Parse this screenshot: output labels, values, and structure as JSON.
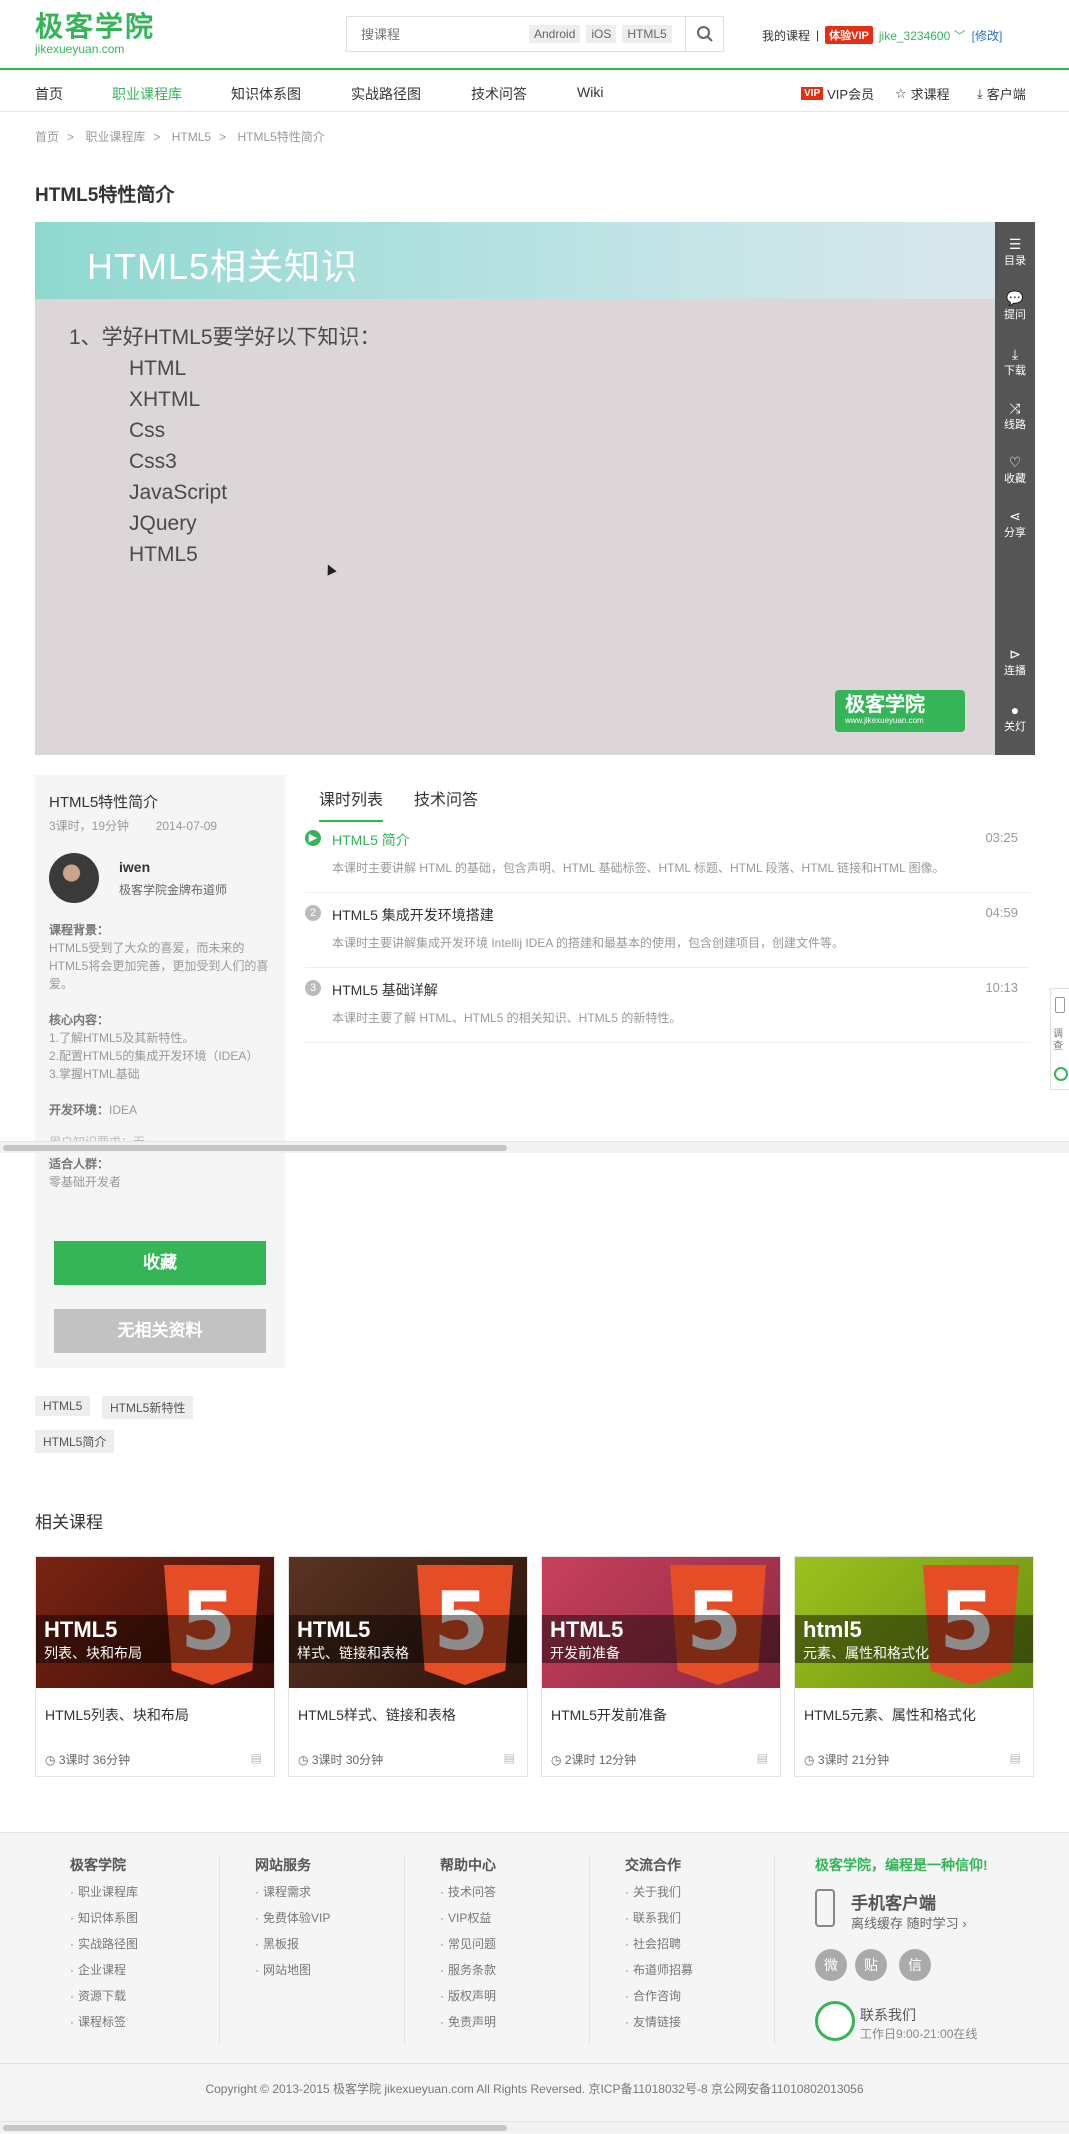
{
  "header": {
    "logo_cn": "极客学院",
    "logo_en": "jikexueyuan.com",
    "search_placeholder": "搜课程",
    "search_tags": [
      "Android",
      "iOS",
      "HTML5"
    ],
    "my_courses": "我的课程",
    "sep": "|",
    "vip_badge": "体验VIP",
    "username": "jike_3234600",
    "edit": "[修改]"
  },
  "nav": {
    "items": [
      "首页",
      "职业课程库",
      "知识体系图",
      "实战路径图",
      "技术问答",
      "Wiki"
    ],
    "right_vip_tag": "VIP",
    "right_vip": "VIP会员",
    "right_ask": "求课程",
    "right_client": "客户端"
  },
  "breadcrumb": [
    "首页",
    "职业课程库",
    "HTML5",
    "HTML5特性简介"
  ],
  "breadcrumb_sep": ">",
  "page_title": "HTML5特性简介",
  "slide": {
    "title": "HTML5相关知识",
    "line1": "1、学好HTML5要学好以下知识：",
    "items": [
      "HTML",
      "XHTML",
      "Css",
      "Css3",
      "JavaScript",
      "JQuery",
      "HTML5"
    ],
    "watermark": "极客学院",
    "watermark_en": "www.jikexueyuan.com"
  },
  "player_sidebar": [
    {
      "icon": "list-icon",
      "label": "目录"
    },
    {
      "icon": "question-icon",
      "label": "提问"
    },
    {
      "icon": "download-icon",
      "label": "下载"
    },
    {
      "icon": "route-icon",
      "label": "线路"
    },
    {
      "icon": "heart-icon",
      "label": "收藏"
    },
    {
      "icon": "share-icon",
      "label": "分享"
    },
    {
      "icon": "autoplay-icon",
      "label": "连播"
    },
    {
      "icon": "lamp-icon",
      "label": "关灯"
    }
  ],
  "course_info": {
    "title": "HTML5特性简介",
    "lessons_time": "3课时，19分钟",
    "date": "2014-07-09",
    "teacher": "iwen",
    "teacher_title": "极客学院金牌布道师",
    "bg_label": "课程背景：",
    "bg_text": "HTML5受到了大众的喜爱，而未来的HTML5将会更加完善，更加受到人们的喜爱。",
    "core_label": "核心内容：",
    "core_items": [
      "1.了解HTML5及其新特性。",
      "2.配置HTML5的集成开发环境（IDEA）",
      "3.掌握HTML基础"
    ],
    "env_label": "开发环境：",
    "env_value": "IDEA",
    "cut_text": "用户知识要求：无",
    "audience_label": "适合人群：",
    "audience_value": "零基础开发者",
    "btn_collect": "收藏",
    "btn_no_material": "无相关资料"
  },
  "tabs": [
    "课时列表",
    "技术问答"
  ],
  "lessons": [
    {
      "num": "▶",
      "name": "HTML5 简介",
      "duration": "03:25",
      "desc": "本课时主要讲解 HTML 的基础，包含声明、HTML 基础标签、HTML 标题、HTML 段落、HTML 链接和HTML 图像。"
    },
    {
      "num": "2",
      "name": "HTML5 集成开发环境搭建",
      "duration": "04:59",
      "desc": "本课时主要讲解集成开发环境 Intellij IDEA 的搭建和最基本的使用，包含创建项目，创建文件等。"
    },
    {
      "num": "3",
      "name": "HTML5 基础详解",
      "duration": "10:13",
      "desc": "本课时主要了解 HTML、HTML5 的相关知识、HTML5 的新特性。"
    }
  ],
  "side_float": {
    "icon1": "phone-icon",
    "text": "调查"
  },
  "keyword_tags": [
    "HTML5",
    "HTML5新特性",
    "HTML5简介"
  ],
  "related_title": "相关课程",
  "related": [
    {
      "big": "HTML5",
      "small": "列表、块和布局",
      "name": "HTML5列表、块和布局",
      "meta": "3课时 36分钟",
      "bg": "#6b1f12"
    },
    {
      "big": "HTML5",
      "small": "样式、链接和表格",
      "name": "HTML5样式、链接和表格",
      "meta": "3课时 30分钟",
      "bg": "#4a2a1c"
    },
    {
      "big": "HTML5",
      "small": "开发前准备",
      "name": "HTML5开发前准备",
      "meta": "2课时 12分钟",
      "bg": "#b8354f"
    },
    {
      "big": "html5",
      "small": "元素、属性和格式化",
      "name": "HTML5元素、属性和格式化",
      "meta": "3课时 21分钟",
      "bg": "#8db21e"
    }
  ],
  "footer": {
    "cols": [
      {
        "title": "极客学院",
        "items": [
          "职业课程库",
          "知识体系图",
          "实战路径图",
          "企业课程",
          "资源下载",
          "课程标签"
        ]
      },
      {
        "title": "网站服务",
        "items": [
          "课程需求",
          "免费体验VIP",
          "黑板报",
          "网站地图"
        ]
      },
      {
        "title": "帮助中心",
        "items": [
          "技术问答",
          "VIP权益",
          "常见问题",
          "服务条款",
          "版权声明",
          "免责声明"
        ]
      },
      {
        "title": "交流合作",
        "items": [
          "关于我们",
          "联系我们",
          "社会招聘",
          "布道师招募",
          "合作咨询",
          "友情链接"
        ]
      }
    ],
    "slogan": "极客学院，编程是一种信仰!",
    "app_title": "手机客户端",
    "app_sub": "离线缓存 随时学习",
    "social": [
      "微",
      "贴",
      "信"
    ],
    "contact": "联系我们",
    "contact_time": "工作日9:00-21:00在线",
    "copyright": "Copyright © 2013-2015 极客学院 jikexueyuan.com All Rights Reversed. 京ICP备11018032号-8 京公网安备11010802013056"
  },
  "colors": {
    "accent": "#35b558",
    "vip": "#e62e13",
    "link": "#2a6fc9"
  }
}
